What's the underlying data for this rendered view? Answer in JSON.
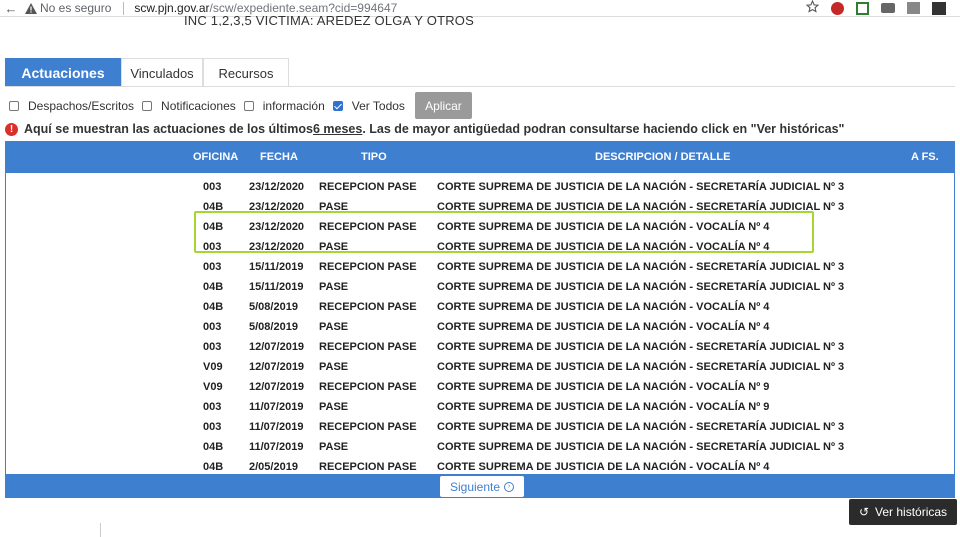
{
  "browser": {
    "security_text": "No es seguro",
    "url_host": "scw.pjn.gov.ar",
    "url_path": "/scw/expediente.seam?cid=994647"
  },
  "subtitle": "INC 1,2,3,5  VICTIMA: AREDEZ OLGA Y OTROS",
  "tabs": [
    {
      "label": "Actuaciones"
    },
    {
      "label": "Vinculados"
    },
    {
      "label": "Recursos"
    }
  ],
  "filters": [
    {
      "label": "Despachos/Escritos",
      "checked": false
    },
    {
      "label": "Notificaciones",
      "checked": false
    },
    {
      "label": "información",
      "checked": false
    },
    {
      "label": "Ver Todos",
      "checked": true
    }
  ],
  "apply_label": "Aplicar",
  "notice": {
    "before": "Aquí se muestran las actuaciones de los últimos ",
    "emph": "6 meses",
    "after": ". Las de mayor antigüedad podran consultarse haciendo click en \"Ver históricas\""
  },
  "table": {
    "headers": {
      "oficina": "OFICINA",
      "fecha": "FECHA",
      "tipo": "TIPO",
      "desc": "DESCRIPCION / DETALLE",
      "afs": "A FS."
    },
    "rows": [
      {
        "oficina": "003",
        "fecha": "23/12/2020",
        "tipo": "RECEPCION PASE",
        "desc": "CORTE SUPREMA DE JUSTICIA DE LA NACIÓN - SECRETARÍA JUDICIAL Nº 3"
      },
      {
        "oficina": "04B",
        "fecha": "23/12/2020",
        "tipo": "PASE",
        "desc": "CORTE SUPREMA DE JUSTICIA DE LA NACIÓN - SECRETARÍA JUDICIAL Nº 3"
      },
      {
        "oficina": "04B",
        "fecha": "23/12/2020",
        "tipo": "RECEPCION PASE",
        "desc": "CORTE SUPREMA DE JUSTICIA DE LA NACIÓN - VOCALÍA Nº 4"
      },
      {
        "oficina": "003",
        "fecha": "23/12/2020",
        "tipo": "PASE",
        "desc": "CORTE SUPREMA DE JUSTICIA DE LA NACIÓN - VOCALÍA Nº 4"
      },
      {
        "oficina": "003",
        "fecha": "15/11/2019",
        "tipo": "RECEPCION PASE",
        "desc": "CORTE SUPREMA DE JUSTICIA DE LA NACIÓN - SECRETARÍA JUDICIAL Nº 3"
      },
      {
        "oficina": "04B",
        "fecha": "15/11/2019",
        "tipo": "PASE",
        "desc": "CORTE SUPREMA DE JUSTICIA DE LA NACIÓN - SECRETARÍA JUDICIAL Nº 3"
      },
      {
        "oficina": "04B",
        "fecha": "5/08/2019",
        "tipo": "RECEPCION PASE",
        "desc": "CORTE SUPREMA DE JUSTICIA DE LA NACIÓN - VOCALÍA Nº 4"
      },
      {
        "oficina": "003",
        "fecha": "5/08/2019",
        "tipo": "PASE",
        "desc": "CORTE SUPREMA DE JUSTICIA DE LA NACIÓN - VOCALÍA Nº 4"
      },
      {
        "oficina": "003",
        "fecha": "12/07/2019",
        "tipo": "RECEPCION PASE",
        "desc": "CORTE SUPREMA DE JUSTICIA DE LA NACIÓN - SECRETARÍA JUDICIAL Nº 3"
      },
      {
        "oficina": "V09",
        "fecha": "12/07/2019",
        "tipo": "PASE",
        "desc": "CORTE SUPREMA DE JUSTICIA DE LA NACIÓN - SECRETARÍA JUDICIAL Nº 3"
      },
      {
        "oficina": "V09",
        "fecha": "12/07/2019",
        "tipo": "RECEPCION PASE",
        "desc": "CORTE SUPREMA DE JUSTICIA DE LA NACIÓN - VOCALÍA Nº 9"
      },
      {
        "oficina": "003",
        "fecha": "11/07/2019",
        "tipo": "PASE",
        "desc": "CORTE SUPREMA DE JUSTICIA DE LA NACIÓN - VOCALÍA Nº 9"
      },
      {
        "oficina": "003",
        "fecha": "11/07/2019",
        "tipo": "RECEPCION PASE",
        "desc": "CORTE SUPREMA DE JUSTICIA DE LA NACIÓN - SECRETARÍA JUDICIAL Nº 3"
      },
      {
        "oficina": "04B",
        "fecha": "11/07/2019",
        "tipo": "PASE",
        "desc": "CORTE SUPREMA DE JUSTICIA DE LA NACIÓN - SECRETARÍA JUDICIAL Nº 3"
      },
      {
        "oficina": "04B",
        "fecha": "2/05/2019",
        "tipo": "RECEPCION PASE",
        "desc": "CORTE SUPREMA DE JUSTICIA DE LA NACIÓN - VOCALÍA Nº 4"
      }
    ]
  },
  "next_label": "Siguiente",
  "historicas_label": "Ver históricas",
  "colors": {
    "accent": "#3f7fcf",
    "highlight": "#a6d633",
    "alert": "#d9302c"
  },
  "icons": [
    "back-arrow-icon",
    "warning-icon",
    "star-icon",
    "next-circle-icon",
    "history-icon"
  ]
}
